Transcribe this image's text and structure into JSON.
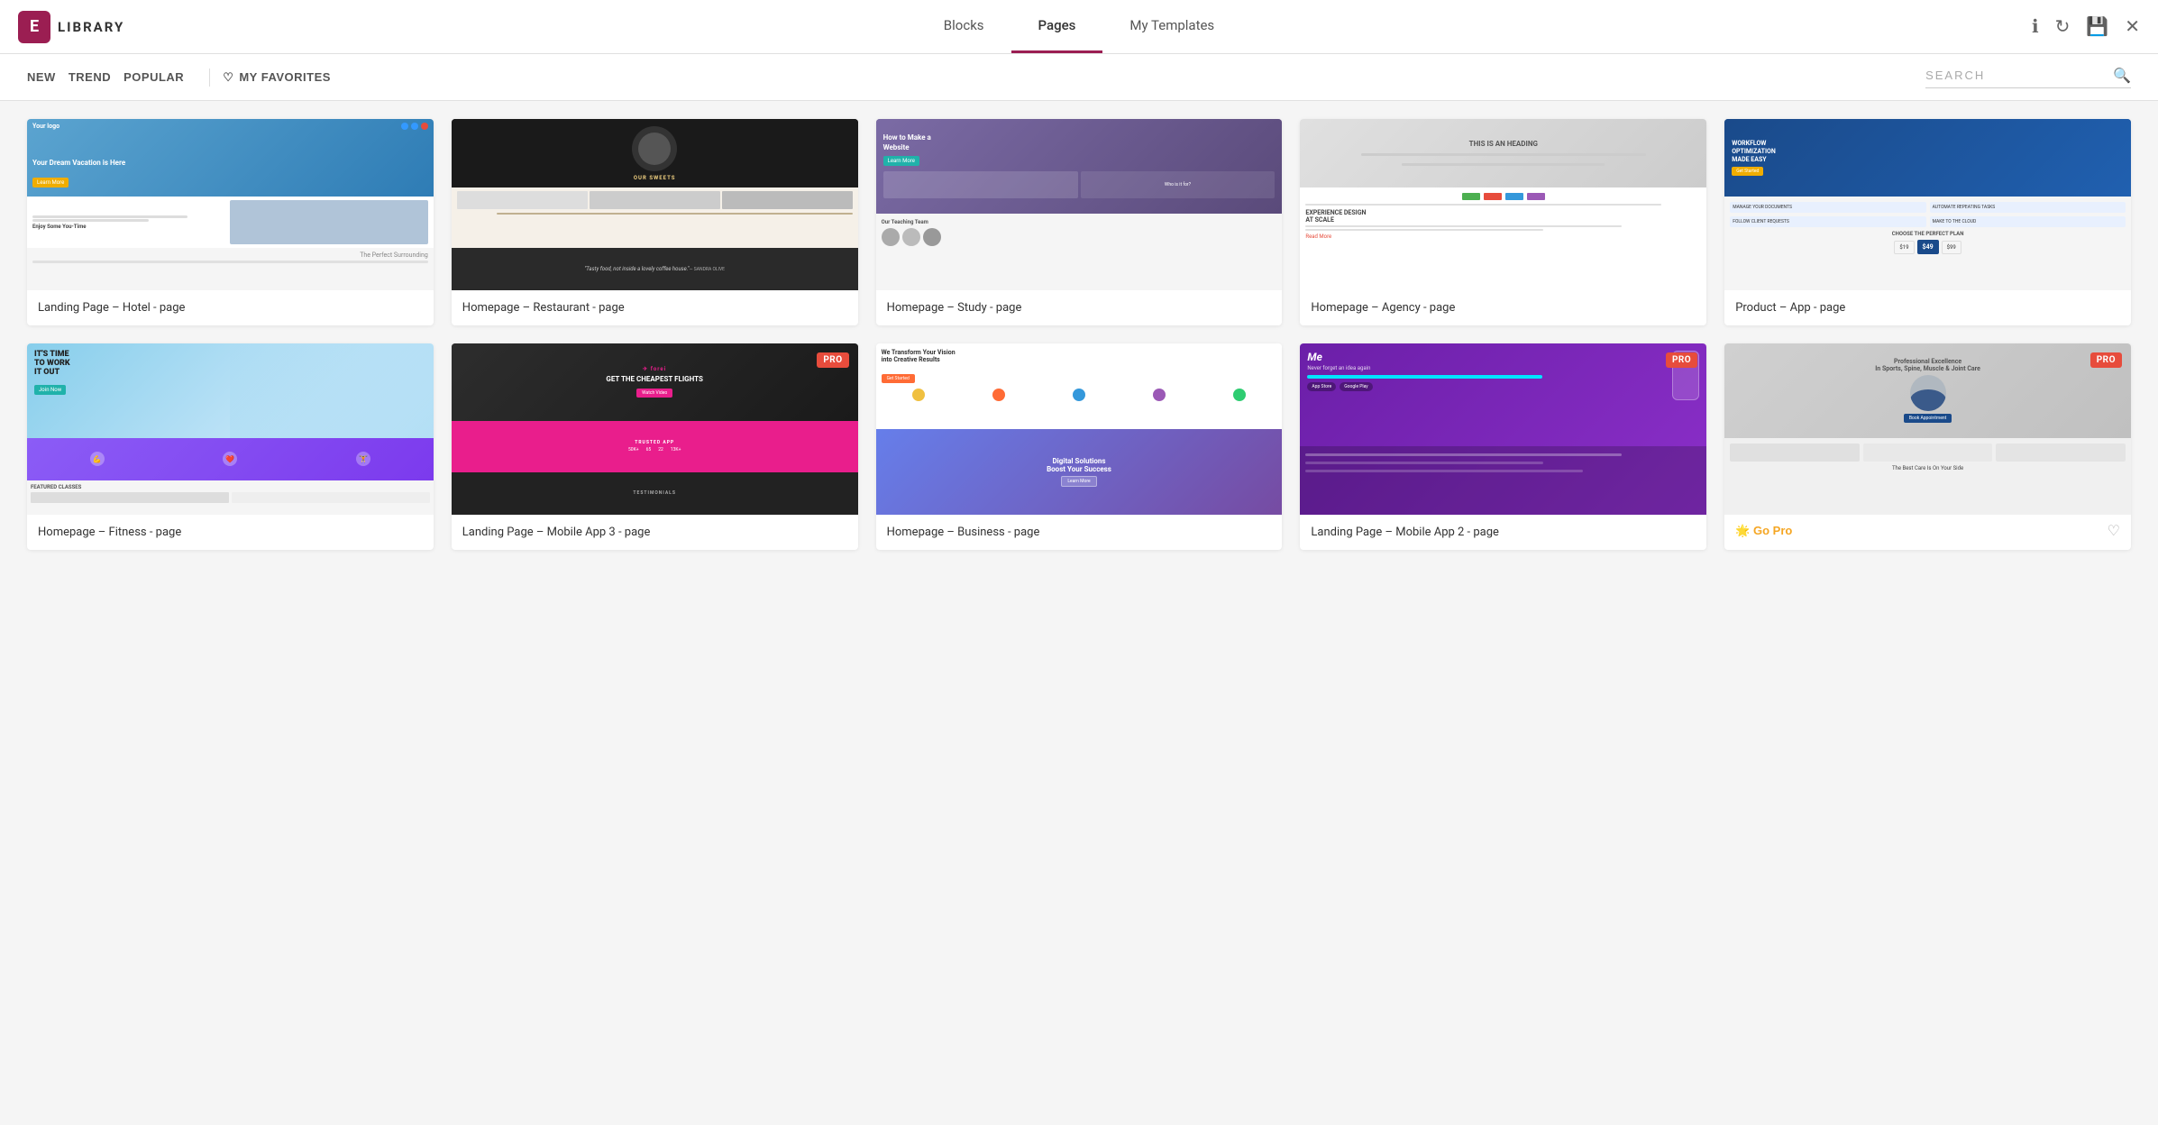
{
  "header": {
    "logo_letter": "E",
    "logo_text": "LIBRARY",
    "tabs": [
      {
        "id": "blocks",
        "label": "Blocks",
        "active": false
      },
      {
        "id": "pages",
        "label": "Pages",
        "active": true
      },
      {
        "id": "my-templates",
        "label": "My Templates",
        "active": false
      }
    ],
    "actions": {
      "info_icon": "ℹ",
      "refresh_icon": "↻",
      "save_icon": "💾",
      "close_icon": "✕"
    }
  },
  "filter_bar": {
    "filters": [
      {
        "id": "new",
        "label": "NEW"
      },
      {
        "id": "trend",
        "label": "TREND"
      },
      {
        "id": "popular",
        "label": "POPULAR"
      }
    ],
    "favorites_label": "MY FAVORITES",
    "search_placeholder": "SEARCH"
  },
  "cards": [
    {
      "id": "hotel",
      "label": "Landing Page – Hotel - page",
      "pro": false,
      "theme": "hotel"
    },
    {
      "id": "restaurant",
      "label": "Homepage – Restaurant - page",
      "pro": false,
      "theme": "restaurant"
    },
    {
      "id": "study",
      "label": "Homepage – Study - page",
      "pro": false,
      "theme": "study"
    },
    {
      "id": "agency",
      "label": "Homepage – Agency - page",
      "pro": false,
      "theme": "agency"
    },
    {
      "id": "product-app",
      "label": "Product – App - page",
      "pro": false,
      "theme": "product"
    },
    {
      "id": "fitness",
      "label": "Homepage – Fitness - page",
      "pro": false,
      "theme": "fitness"
    },
    {
      "id": "mobile-app-3",
      "label": "Landing Page – Mobile App 3 - page",
      "pro": true,
      "theme": "mobile3"
    },
    {
      "id": "business",
      "label": "Homepage – Business - page",
      "pro": false,
      "theme": "business"
    },
    {
      "id": "mobile-app-2",
      "label": "Landing Page – Mobile App 2 - page",
      "pro": true,
      "theme": "mobile2"
    },
    {
      "id": "medical",
      "label": "Go Pro",
      "go_pro": true,
      "pro": true,
      "theme": "medical"
    }
  ],
  "go_pro": {
    "label": "🌟 Go Pro",
    "icon": "♡"
  }
}
